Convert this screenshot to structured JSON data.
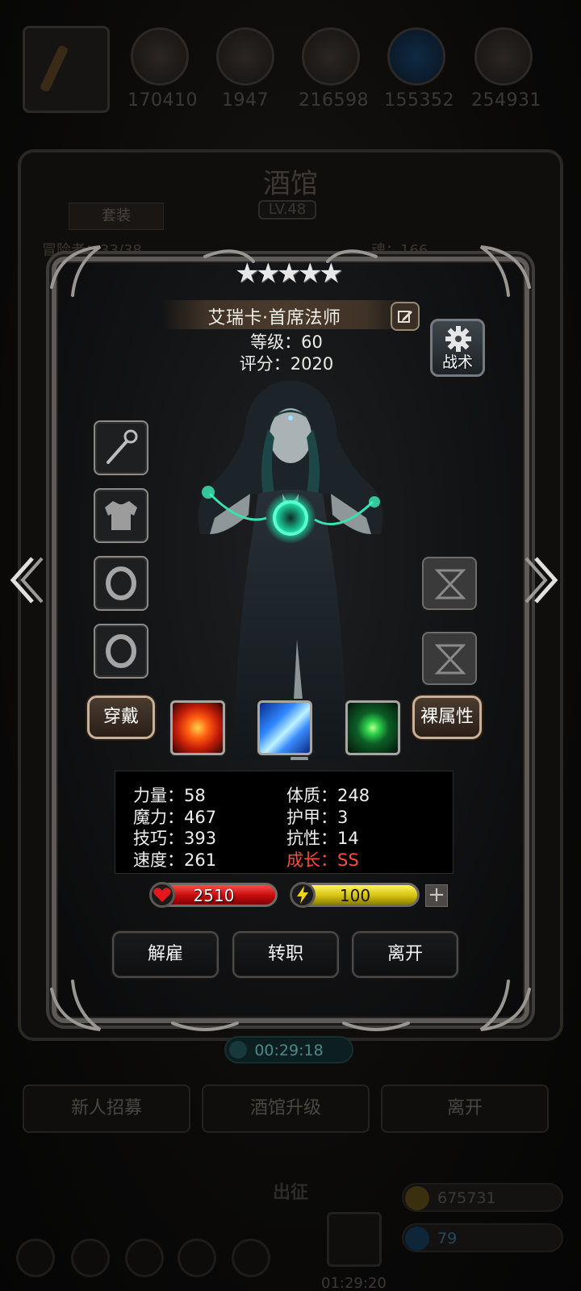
{
  "background": {
    "resources": [
      {
        "icon": "axe-icon",
        "value": "170410"
      },
      {
        "icon": "log-icon",
        "value": "1947"
      },
      {
        "icon": "ore-icon",
        "value": "216598"
      },
      {
        "icon": "crystal-icon",
        "value": "155352"
      },
      {
        "icon": "iron-icon",
        "value": "254931"
      }
    ],
    "tavern_title": "酒馆",
    "tavern_level": "LV.48",
    "suit_tab": "套装",
    "row_left": "冒险者：33/38",
    "row_right": "魂：166",
    "timer": "00:29:18",
    "buttons": [
      "新人招募",
      "酒馆升级",
      "离开"
    ],
    "deploy_label": "出征",
    "gift_timer": "01:29:20",
    "gold": "675731",
    "gems": "79"
  },
  "hero": {
    "stars": 5,
    "name": "艾瑞卡·首席法师",
    "level_text": "等级：60",
    "score_text": "评分：2020",
    "tactic_label": "战术",
    "equip_slots": [
      "staff-icon",
      "armor-icon",
      "ring-icon",
      "ring-icon"
    ],
    "wear_label": "穿戴",
    "naked_attr_label": "裸属性",
    "skills": [
      "fire-skill-icon",
      "ice-skill-icon",
      "nature-skill-icon"
    ],
    "stats": {
      "strength": "力量：58",
      "constitution": "体质：248",
      "magic": "魔力：467",
      "armor": "护甲：3",
      "skill": "技巧：393",
      "resistance": "抗性：14",
      "speed": "速度：261",
      "growth": "成长：SS"
    },
    "hp": "2510",
    "energy": "100",
    "plus_label": "+",
    "actions": {
      "dismiss": "解雇",
      "job_change": "转职",
      "leave": "离开"
    }
  },
  "colors": {
    "growth": "#ff4a3c",
    "hp_bar": "#c60b0b",
    "energy_bar": "#d4c211",
    "accent_wood": "#c9b198"
  }
}
